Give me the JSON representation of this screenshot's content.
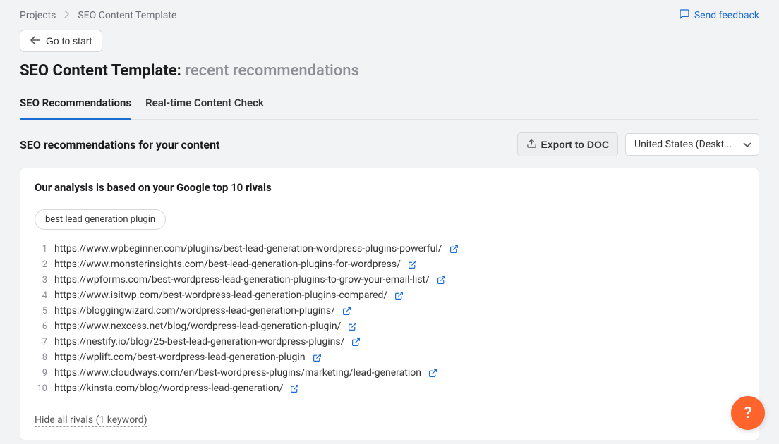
{
  "breadcrumb": {
    "root": "Projects",
    "current": "SEO Content Template"
  },
  "feedback_label": "Send feedback",
  "go_to_start_label": "Go to start",
  "title": {
    "main": "SEO Content Template:",
    "sub": "recent recommendations"
  },
  "tabs": {
    "t0": "SEO Recommendations",
    "t1": "Real-time Content Check"
  },
  "section": {
    "heading": "SEO recommendations for your content",
    "export_label": "Export to DOC",
    "country_label": "United States (Deskt..."
  },
  "panel": {
    "title": "Our analysis is based on your Google top 10 rivals",
    "keyword": "best lead generation plugin",
    "hide_label": "Hide all rivals (1 keyword)"
  },
  "rivals": [
    {
      "n": "1",
      "url": "https://www.wpbeginner.com/plugins/best-lead-generation-wordpress-plugins-powerful/"
    },
    {
      "n": "2",
      "url": "https://www.monsterinsights.com/best-lead-generation-plugins-for-wordpress/"
    },
    {
      "n": "3",
      "url": "https://wpforms.com/best-wordpress-lead-generation-plugins-to-grow-your-email-list/"
    },
    {
      "n": "4",
      "url": "https://www.isitwp.com/best-wordpress-lead-generation-plugins-compared/"
    },
    {
      "n": "5",
      "url": "https://bloggingwizard.com/wordpress-lead-generation-plugins/"
    },
    {
      "n": "6",
      "url": "https://www.nexcess.net/blog/wordpress-lead-generation-plugin/"
    },
    {
      "n": "7",
      "url": "https://nestify.io/blog/25-best-lead-generation-wordpress-plugins/"
    },
    {
      "n": "8",
      "url": "https://wplift.com/best-wordpress-lead-generation-plugin"
    },
    {
      "n": "9",
      "url": "https://www.cloudways.com/en/best-wordpress-plugins/marketing/lead-generation"
    },
    {
      "n": "10",
      "url": "https://kinsta.com/blog/wordpress-lead-generation/"
    }
  ],
  "fab_label": "?"
}
